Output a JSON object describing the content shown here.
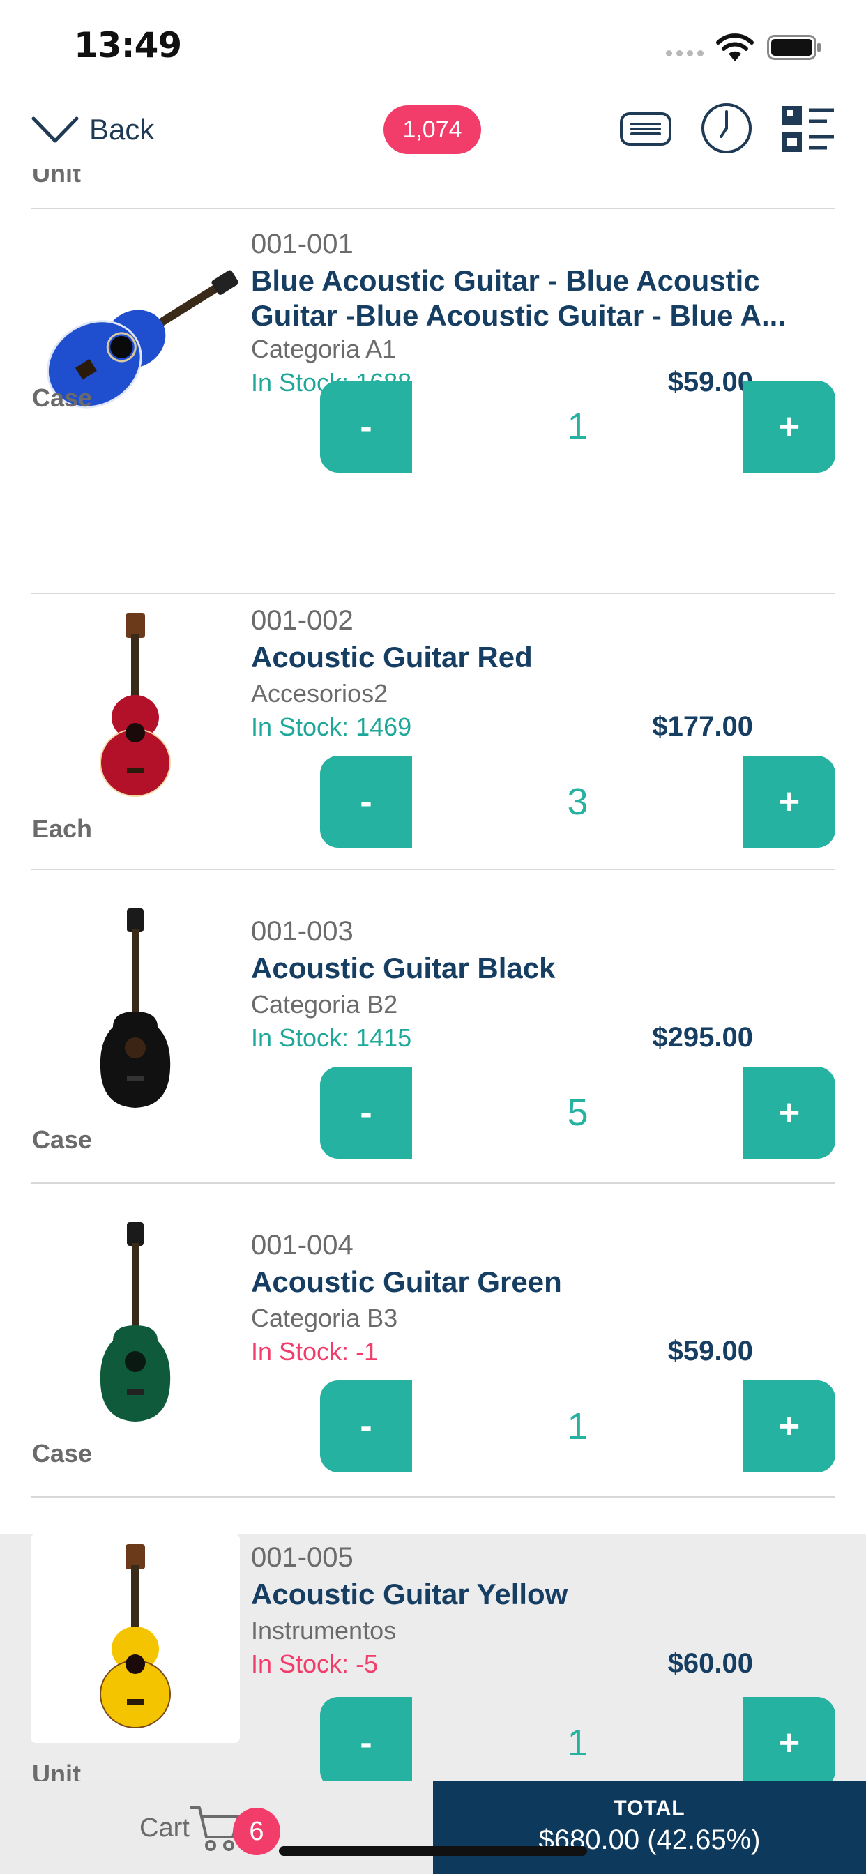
{
  "status_bar": {
    "time": "13:49"
  },
  "nav": {
    "back_label": "Back",
    "count_badge": "1,074"
  },
  "list": {
    "cut_off_unit": "Unit",
    "items": [
      {
        "sku": "001-001",
        "name": "Blue Acoustic Guitar - Blue Acoustic Guitar -Blue Acoustic Guitar - Blue A...",
        "category": "Categoria A1",
        "stock": "In Stock: 1688",
        "price": "$59.00",
        "unit": "Case",
        "quantity": "1",
        "minus_label": "-",
        "plus_label": "+",
        "body_color": "#1f4fcf"
      },
      {
        "sku": "001-002",
        "name": "Acoustic Guitar Red",
        "category": "Accesorios2",
        "stock": "In Stock: 1469",
        "price": "$177.00",
        "unit": "Each",
        "quantity": "3",
        "minus_label": "-",
        "plus_label": "+",
        "body_color": "#b3112a"
      },
      {
        "sku": "001-003",
        "name": "Acoustic Guitar Black",
        "category": "Categoria B2",
        "stock": "In Stock: 1415",
        "price": "$295.00",
        "unit": "Case",
        "quantity": "5",
        "minus_label": "-",
        "plus_label": "+",
        "body_color": "#111111"
      },
      {
        "sku": "001-004",
        "name": "Acoustic Guitar Green",
        "category": "Categoria B3",
        "stock": "In Stock: -1",
        "price": "$59.00",
        "unit": "Case",
        "quantity": "1",
        "minus_label": "-",
        "plus_label": "+",
        "body_color": "#0f5a3a"
      },
      {
        "sku": "001-005",
        "name": "Acoustic Guitar Yellow",
        "category": "Instrumentos",
        "stock": "In Stock: -5",
        "price": "$60.00",
        "unit": "Unit",
        "quantity": "1",
        "minus_label": "-",
        "plus_label": "+",
        "body_color": "#f5c400"
      }
    ]
  },
  "bottom_bar": {
    "cart_label": "Cart",
    "cart_count": "6",
    "total_label": "TOTAL",
    "total_value": "$680.00 (42.65%)"
  },
  "colors": {
    "accent": "#25b2a1",
    "badge": "#f23c6a",
    "navy": "#0d3a5c"
  },
  "icons": [
    "wifi-icon",
    "battery-icon",
    "chevron-down-icon",
    "message-icon",
    "clock-icon",
    "grid-view-icon",
    "cart-icon",
    "guitar-icon"
  ]
}
